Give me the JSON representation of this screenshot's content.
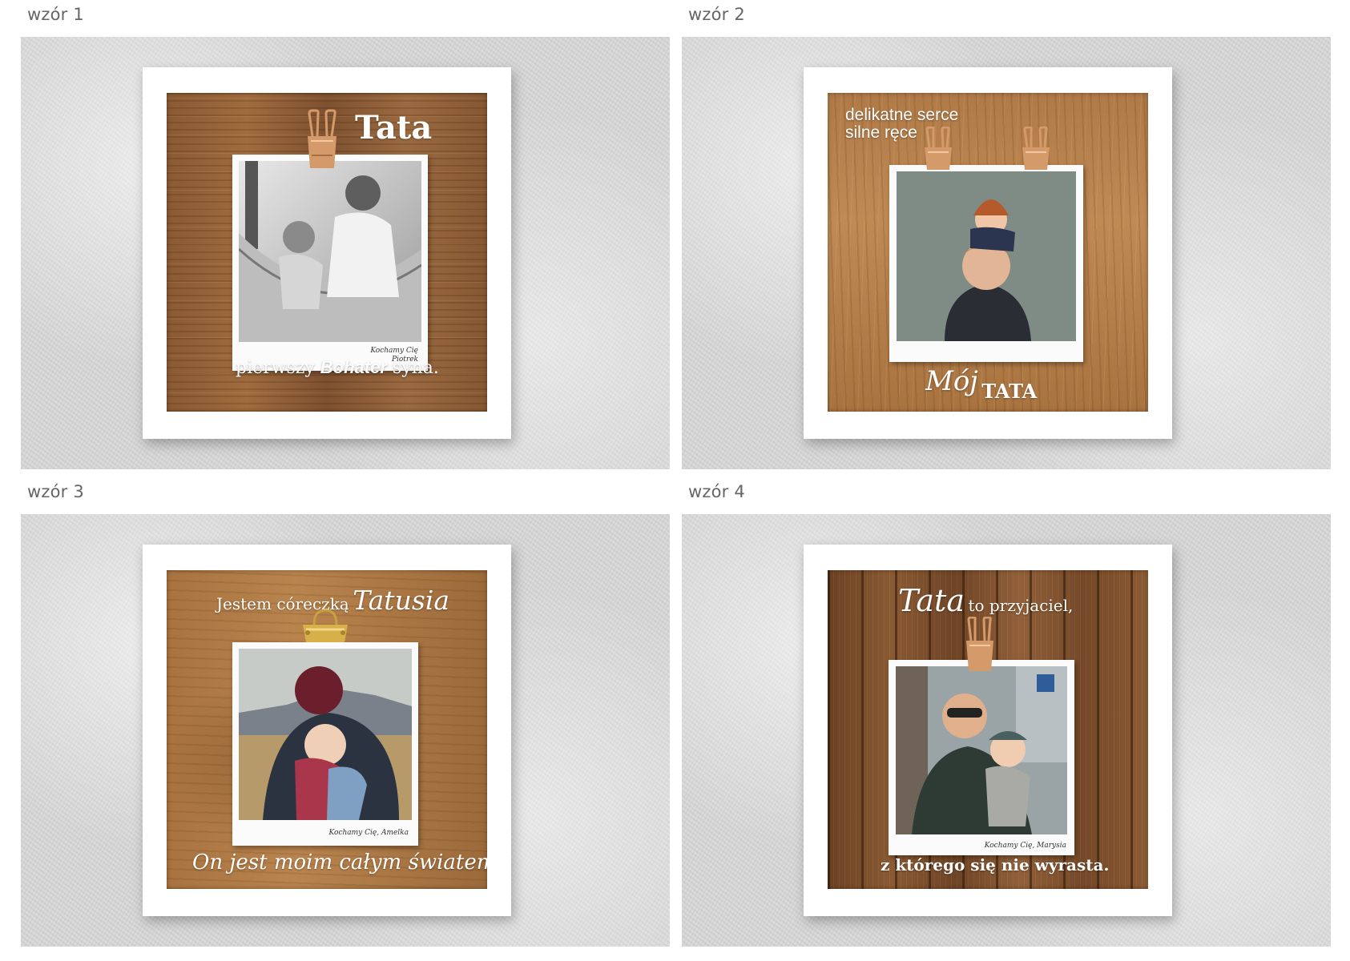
{
  "designs": [
    {
      "label": "wzór 1",
      "title": "Tata",
      "bottom_prefix": "pierwszy",
      "bottom_bold": "Bohater",
      "bottom_suffix": "syna.",
      "signature_line1": "Kochamy Cię",
      "signature_line2": "Piotrek"
    },
    {
      "label": "wzór 2",
      "top_line1": "delikatne serce",
      "top_line2": "silne ręce",
      "bottom_script": "Mój",
      "bottom_caps": "TATA"
    },
    {
      "label": "wzór 3",
      "top_plain": "Jestem córeczką",
      "top_script": "Tatusia",
      "bottom_script": "On jest moim całym światem",
      "signature_line1": "Kochamy Cię, Amelka"
    },
    {
      "label": "wzór 4",
      "top_script": "Tata",
      "top_plain": "to przyjaciel,",
      "bottom_plain": "z którego się nie wyrasta.",
      "signature_line1": "Kochamy Cię, Marysia"
    }
  ],
  "colors": {
    "clip_copper": "#d49a6a",
    "clip_gold": "#d8b04a",
    "text": "#ffffff"
  }
}
